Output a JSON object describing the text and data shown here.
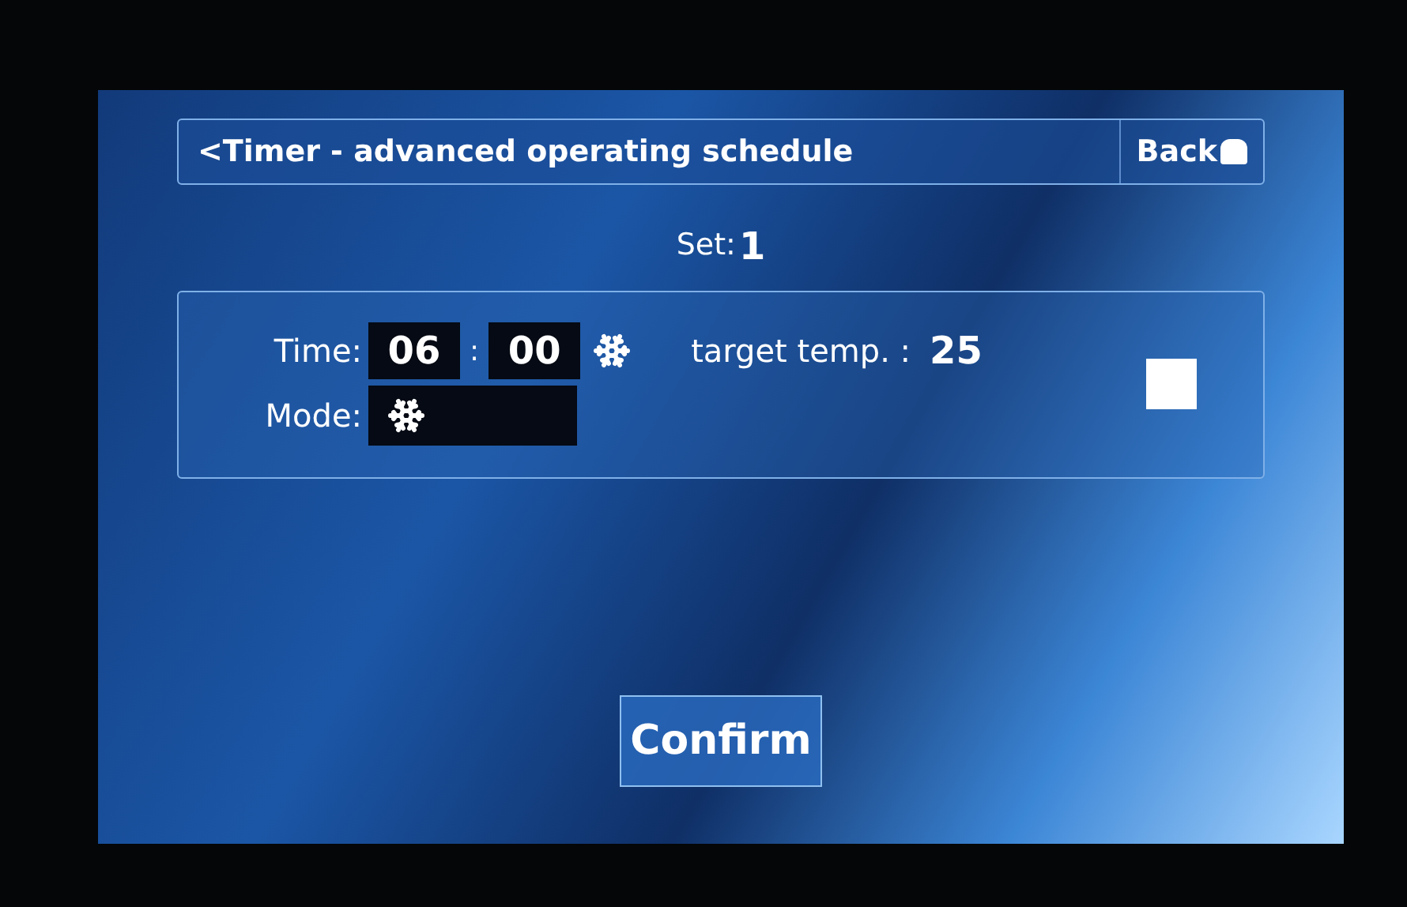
{
  "header": {
    "title": "<Timer - advanced operating schedule",
    "back": "Back"
  },
  "set": {
    "label": "Set:",
    "value": "1"
  },
  "schedule": {
    "time_label": "Time:",
    "hour": "06",
    "separator": ":",
    "minute": "00",
    "temp_label": "target temp. :",
    "temp_value": "25",
    "mode_label": "Mode:",
    "enabled": false
  },
  "confirm": "Confirm"
}
